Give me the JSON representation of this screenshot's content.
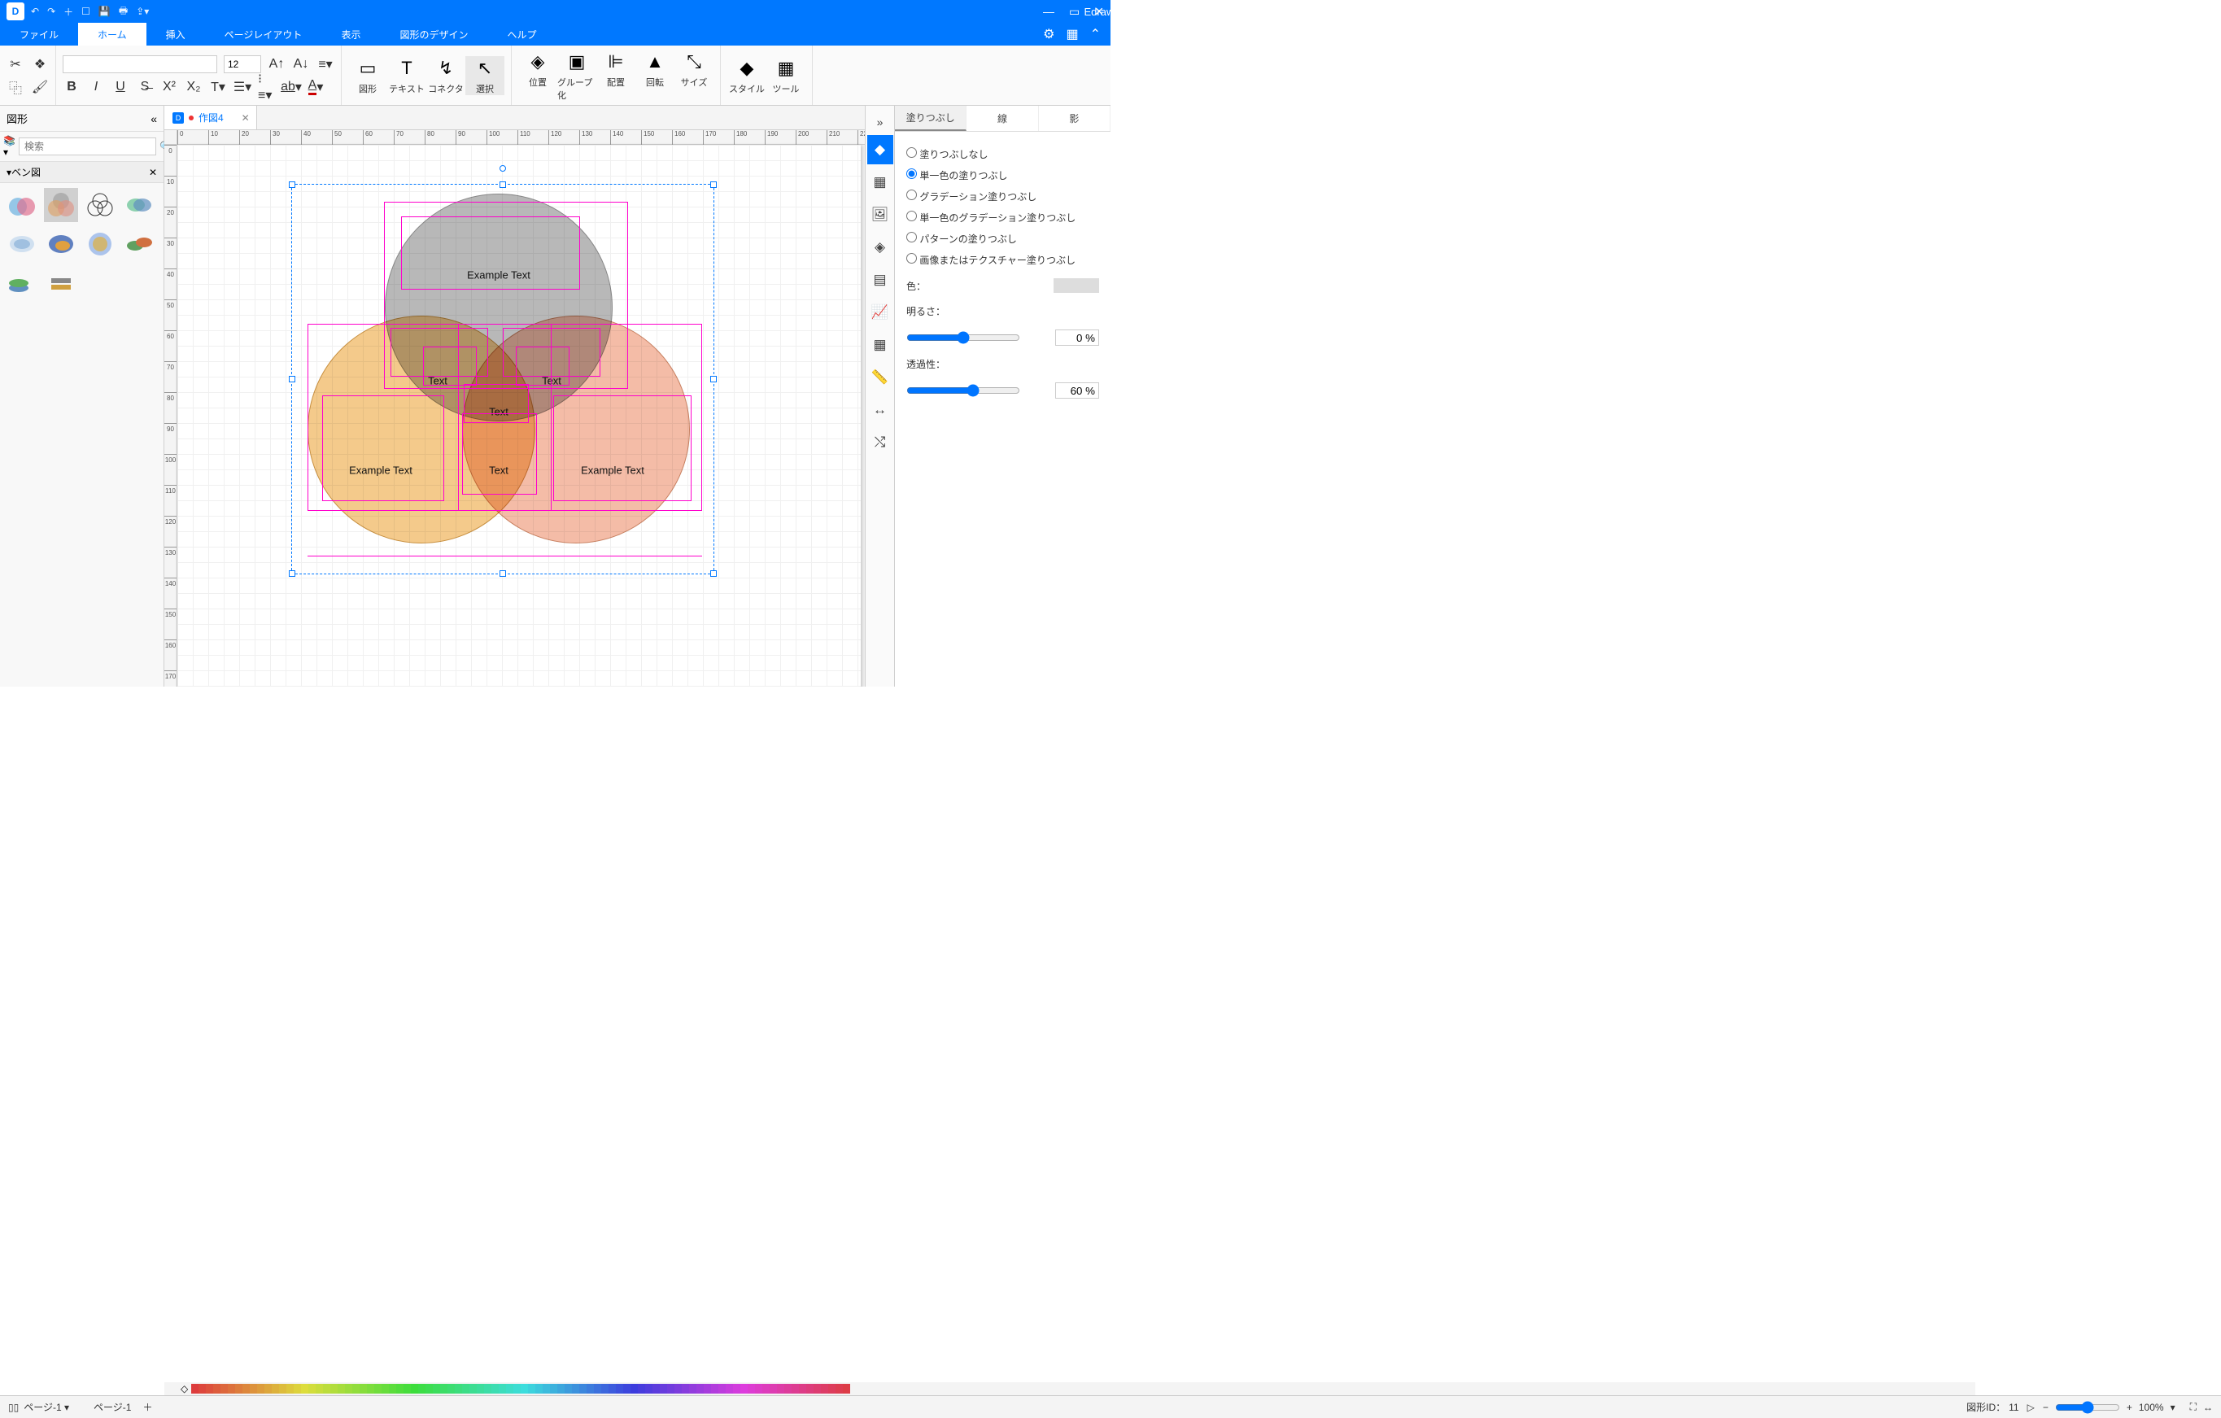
{
  "app": {
    "title": "Edraw Max"
  },
  "menu": {
    "file": "ファイル",
    "tabs": [
      "ホーム",
      "挿入",
      "ページレイアウト",
      "表示",
      "図形のデザイン",
      "ヘルプ"
    ],
    "active": 0
  },
  "ribbon": {
    "font_name": "",
    "font_size": "12",
    "groups": {
      "shape": "図形",
      "text": "テキスト",
      "connector": "コネクタ",
      "select": "選択",
      "position": "位置",
      "group": "グループ化",
      "align": "配置",
      "rotate": "回転",
      "size": "サイズ",
      "style": "スタイル",
      "tools": "ツール"
    }
  },
  "left": {
    "title": "図形",
    "search_placeholder": "検索",
    "category": "ベン図"
  },
  "doc": {
    "tab_name": "作図4"
  },
  "venn": {
    "top": "Example Text",
    "left": "Example Text",
    "right": "Example Text",
    "mid_left": "Text",
    "mid_right": "Text",
    "mid_bottom": "Text",
    "center": "Text"
  },
  "right_panel": {
    "tabs": {
      "fill": "塗りつぶし",
      "line": "線",
      "shadow": "影"
    },
    "options": {
      "none": "塗りつぶしなし",
      "solid": "単一色の塗りつぶし",
      "gradient": "グラデーション塗りつぶし",
      "solid_grad": "単一色のグラデーション塗りつぶし",
      "pattern": "パターンの塗りつぶし",
      "image": "画像またはテクスチャー塗りつぶし"
    },
    "color_label": "色：",
    "brightness_label": "明るさ：",
    "brightness_value": "0 %",
    "opacity_label": "透過性：",
    "opacity_value": "60 %"
  },
  "status": {
    "page_label": "ページ-1",
    "page_tab": "ページ-1",
    "shape_id_label": "図形ID：",
    "shape_id": "11",
    "zoom": "100%"
  }
}
